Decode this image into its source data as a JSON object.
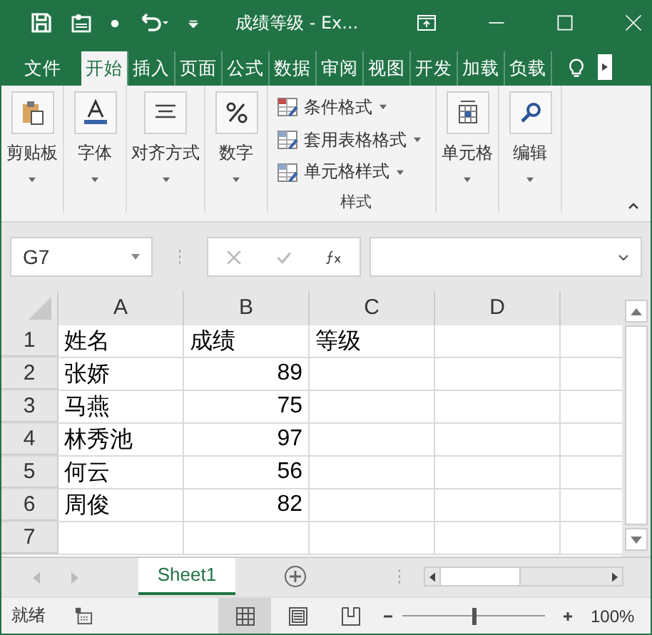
{
  "title_bar": {
    "title": "成绩等级 - Ex..."
  },
  "ribbon_tabs": [
    {
      "label": "文件",
      "selected": false
    },
    {
      "label": "开始",
      "selected": true
    },
    {
      "label": "插入",
      "selected": false
    },
    {
      "label": "页面",
      "selected": false
    },
    {
      "label": "公式",
      "selected": false
    },
    {
      "label": "数据",
      "selected": false
    },
    {
      "label": "审阅",
      "selected": false
    },
    {
      "label": "视图",
      "selected": false
    },
    {
      "label": "开发",
      "selected": false
    },
    {
      "label": "加载",
      "selected": false
    },
    {
      "label": "负载",
      "selected": false
    }
  ],
  "ribbon_groups": [
    {
      "kind": "clipboard",
      "label": "剪贴板"
    },
    {
      "kind": "font",
      "label": "字体"
    },
    {
      "kind": "align",
      "label": "对齐方式"
    },
    {
      "kind": "number",
      "label": "数字"
    },
    {
      "kind": "styles",
      "label": "样式",
      "items": [
        "条件格式",
        "套用表格格式",
        "单元格样式"
      ]
    },
    {
      "kind": "cells",
      "label": "单元格"
    },
    {
      "kind": "edit",
      "label": "编辑"
    }
  ],
  "name_box": {
    "value": "G7"
  },
  "sheet": {
    "columns": [
      "A",
      "B",
      "C",
      "D"
    ],
    "rows": [
      {
        "header": "1",
        "cells": [
          {
            "text": "姓名"
          },
          {
            "text": "成绩"
          },
          {
            "text": "等级"
          }
        ]
      },
      {
        "header": "2",
        "cells": [
          {
            "text": "张娇"
          },
          {
            "text": "89",
            "kind": "number"
          }
        ]
      },
      {
        "header": "3",
        "cells": [
          {
            "text": "马燕"
          },
          {
            "text": "75",
            "kind": "number"
          }
        ]
      },
      {
        "header": "4",
        "cells": [
          {
            "text": "林秀池"
          },
          {
            "text": "97",
            "kind": "number"
          }
        ]
      },
      {
        "header": "5",
        "cells": [
          {
            "text": "何云"
          },
          {
            "text": "56",
            "kind": "number"
          }
        ]
      },
      {
        "header": "6",
        "cells": [
          {
            "text": "周俊"
          },
          {
            "text": "82",
            "kind": "number"
          }
        ]
      },
      {
        "header": "7",
        "cells": []
      }
    ]
  },
  "sheet_tabs": [
    {
      "label": "Sheet1",
      "selected": true
    }
  ],
  "status_bar": {
    "status": "就绪",
    "views": [
      {
        "kind": "normal",
        "selected": true
      },
      {
        "kind": "page-layout",
        "selected": false
      },
      {
        "kind": "page-break",
        "selected": false
      }
    ],
    "zoom": {
      "level": 0.5,
      "reading": "100%"
    }
  }
}
